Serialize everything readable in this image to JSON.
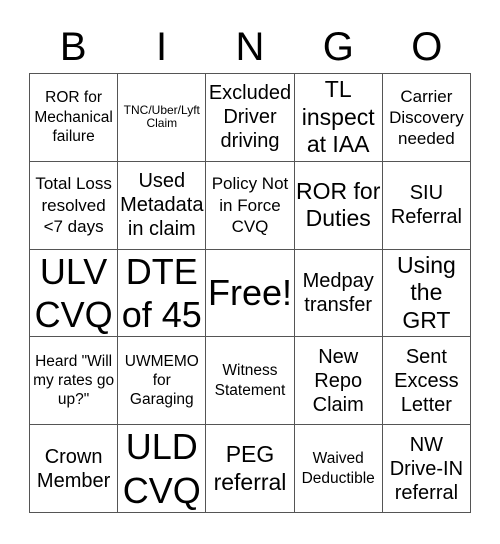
{
  "header": {
    "letters": [
      "B",
      "I",
      "N",
      "G",
      "O"
    ]
  },
  "cells": [
    [
      "ROR for Mechanical failure",
      "TNC/Uber/Lyft Claim",
      "Excluded Driver driving",
      "TL inspect at IAA",
      "Carrier Discovery needed"
    ],
    [
      "Total Loss resolved <7 days",
      "Used Metadata in claim",
      "Policy Not in Force CVQ",
      "ROR for Duties",
      "SIU Referral"
    ],
    [
      "ULV CVQ",
      "DTE of 45",
      "Free!",
      "Medpay transfer",
      "Using the GRT"
    ],
    [
      "Heard \"Will my rates go up?\"",
      "UWMEMO for Garaging",
      "Witness Statement",
      "New Repo Claim",
      "Sent Excess Letter"
    ],
    [
      "Crown Member",
      "ULD CVQ",
      "PEG referral",
      "Waived Deductible",
      "NW Drive-IN referral"
    ]
  ]
}
